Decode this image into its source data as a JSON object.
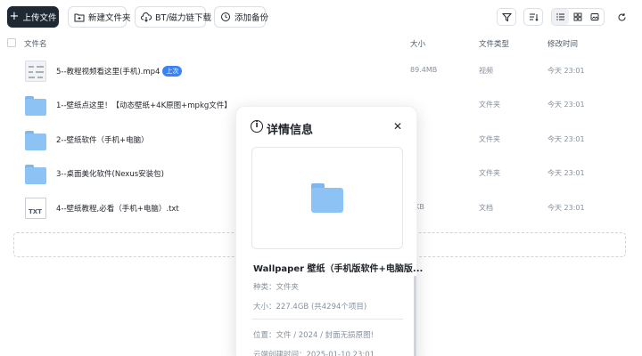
{
  "toolbar": {
    "upload_label": "上传文件",
    "new_folder_label": "新建文件夹",
    "bt_label": "BT/磁力链下载",
    "add_backup_label": "添加备份"
  },
  "table": {
    "headers": {
      "name": "文件名",
      "size": "大小",
      "type": "文件类型",
      "date": "修改时间"
    },
    "rows": [
      {
        "name": "5--教程视频看这里(手机).mp4",
        "badge": "上次",
        "size": "89.4MB",
        "type": "视频",
        "date": "今天 23:01",
        "kind": "video"
      },
      {
        "name": "1--壁纸点这里！【动态壁纸+4K原图+mpkg文件】",
        "size": "",
        "type": "文件夹",
        "date": "今天 23:01",
        "kind": "folder"
      },
      {
        "name": "2--壁纸软件（手机+电脑）",
        "size": "",
        "type": "文件夹",
        "date": "今天 23:01",
        "kind": "folder"
      },
      {
        "name": "3--桌面美化软件(Nexus安装包)",
        "size": "",
        "type": "文件夹",
        "date": "今天 23:01",
        "kind": "folder"
      },
      {
        "name": "4--壁纸教程,必看（手机+电脑）.txt",
        "size": "3KB",
        "type": "文档",
        "date": "今天 23:01",
        "kind": "txt",
        "thumb_text": "TXT"
      }
    ]
  },
  "modal": {
    "title": "详情信息",
    "file_name": "Wallpaper 壁纸（手机版软件+电脑版...",
    "kind_line": "种类：文件夹",
    "size_line": "大小：227.4GB (共4294个项目)",
    "location_line": "位置：文件 / 2024 / 封面无损原图!",
    "created_line": "云端创建时间：2025-01-10 23:01"
  },
  "colors": {
    "primary_button": "#1f2933",
    "badge": "#3b82f6",
    "folder": "#8cc3f4"
  }
}
